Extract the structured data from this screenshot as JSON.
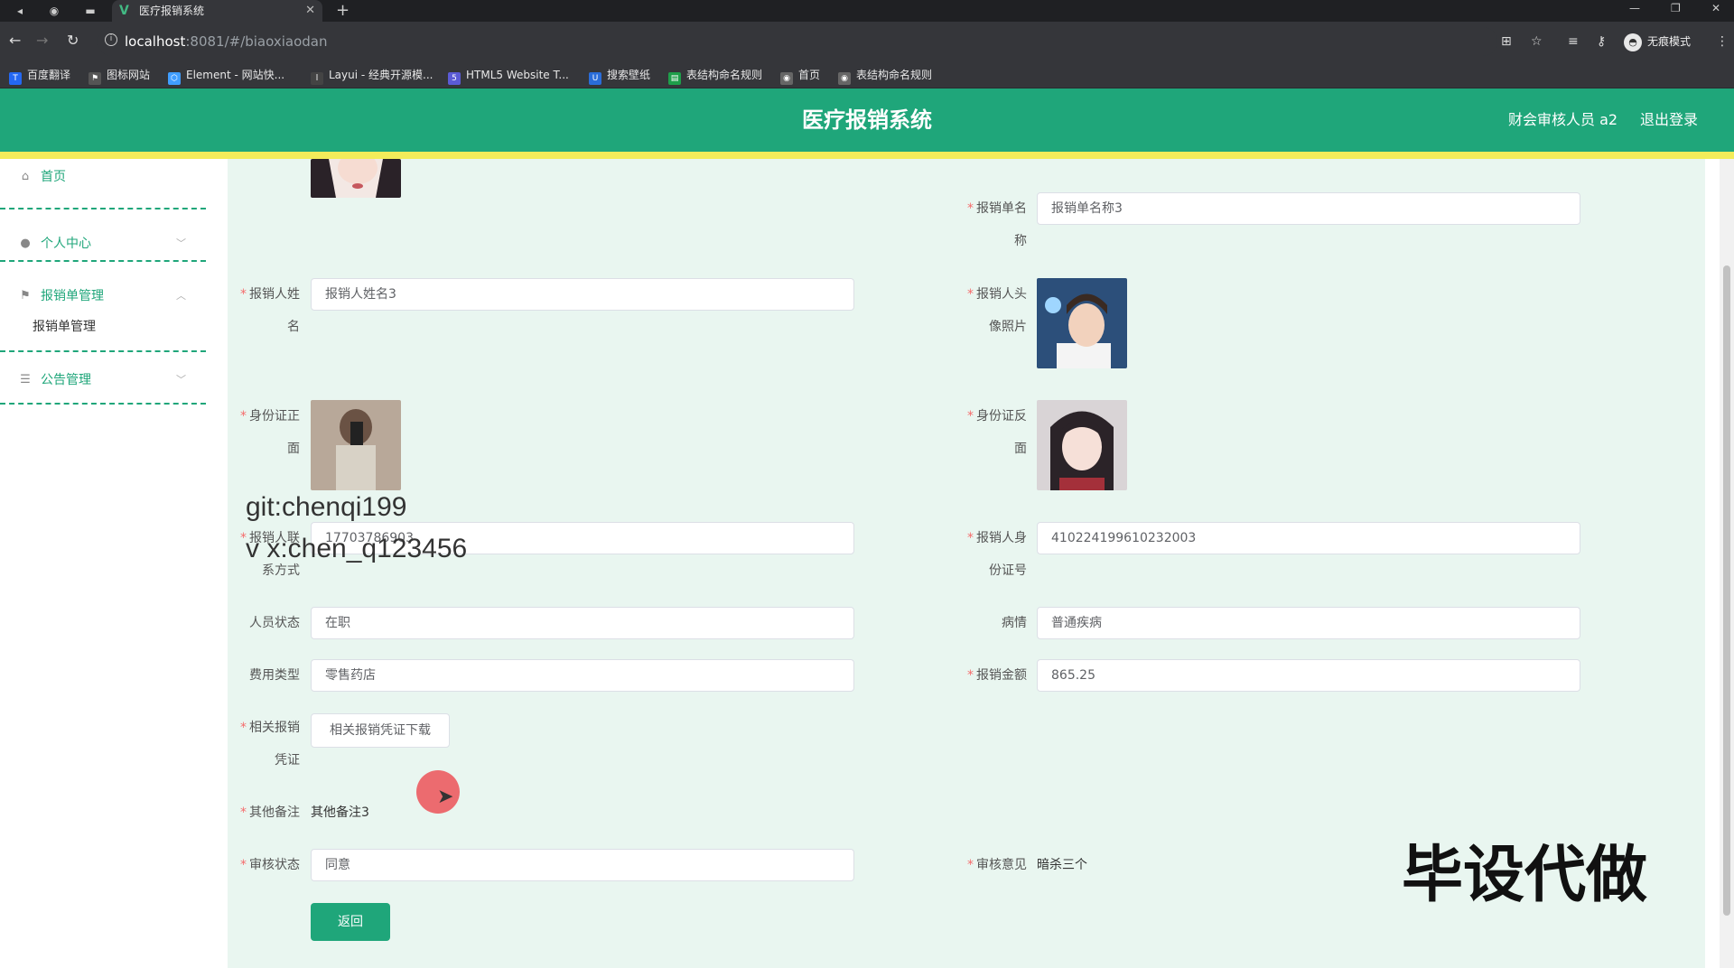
{
  "browser": {
    "tab_title": "医疗报销系统",
    "tab_icon": "vue-logo-icon",
    "url_host": "localhost",
    "url_rest": ":8081/#/biaoxiaodan",
    "incognito_label": "无痕模式",
    "bookmarks": [
      {
        "label": "百度翻译",
        "icon": "baidu-translate-icon",
        "color": "#2468f2"
      },
      {
        "label": "图标网站",
        "icon": "flag-icon",
        "color": "#555555"
      },
      {
        "label": "Element - 网站快...",
        "icon": "element-icon",
        "color": "#409eff"
      },
      {
        "label": "Layui - 经典开源模...",
        "icon": "layui-icon",
        "color": "#444444"
      },
      {
        "label": "HTML5 Website T...",
        "icon": "html5-icon",
        "color": "#5b5bd6"
      },
      {
        "label": "搜索壁纸",
        "icon": "wallpaper-icon",
        "color": "#2a6dd9"
      },
      {
        "label": "表结构命名规则",
        "icon": "sheet-icon",
        "color": "#1e9e4a"
      },
      {
        "label": "首页",
        "icon": "globe-icon",
        "color": "#666666"
      },
      {
        "label": "表结构命名规则",
        "icon": "globe-icon",
        "color": "#666666"
      }
    ]
  },
  "header": {
    "title": "医疗报销系统",
    "user": "财会审核人员 a2",
    "logout": "退出登录",
    "color": "#1fa67a"
  },
  "sidebar": {
    "items": [
      {
        "label": "首页",
        "icon": "home-icon"
      },
      {
        "label": "个人中心",
        "icon": "user-icon"
      },
      {
        "label": "报销单管理",
        "icon": "flag-icon"
      },
      {
        "label": "公告管理",
        "icon": "sliders-icon"
      }
    ],
    "sub_item": "报销单管理"
  },
  "form": {
    "form_name_label": [
      "报销单名",
      "称"
    ],
    "form_name_value": "报销单名称3",
    "name_label": [
      "报销人姓",
      "名"
    ],
    "name_value": "报销人姓名3",
    "avatar_label": [
      "报销人头",
      "像照片"
    ],
    "id_front_label": [
      "身份证正",
      "面"
    ],
    "id_back_label": [
      "身份证反",
      "面"
    ],
    "phone_label": [
      "报销人联",
      "系方式"
    ],
    "phone_value": "17703786903",
    "id_number_label": [
      "报销人身",
      "份证号"
    ],
    "id_number_value": "410224199610232003",
    "status_label": "人员状态",
    "status_value": "在职",
    "illness_label": "病情",
    "illness_value": "普通疾病",
    "fee_type_label": "费用类型",
    "fee_type_value": "零售药店",
    "amount_label": "报销金额",
    "amount_value": "865.25",
    "voucher_label": [
      "相关报销",
      "凭证"
    ],
    "voucher_button": "相关报销凭证下载",
    "remark_label": "其他备注",
    "remark_value": "其他备注3",
    "review_status_label": "审核状态",
    "review_status_value": "同意",
    "review_opinion_label": "审核意见",
    "review_opinion_value": "暗杀三个",
    "back_button": "返回"
  },
  "overlay": {
    "watermark_line1": "git:chenqi199",
    "watermark_line2": "v x:chen_q123456",
    "stamp": "毕设代做"
  }
}
